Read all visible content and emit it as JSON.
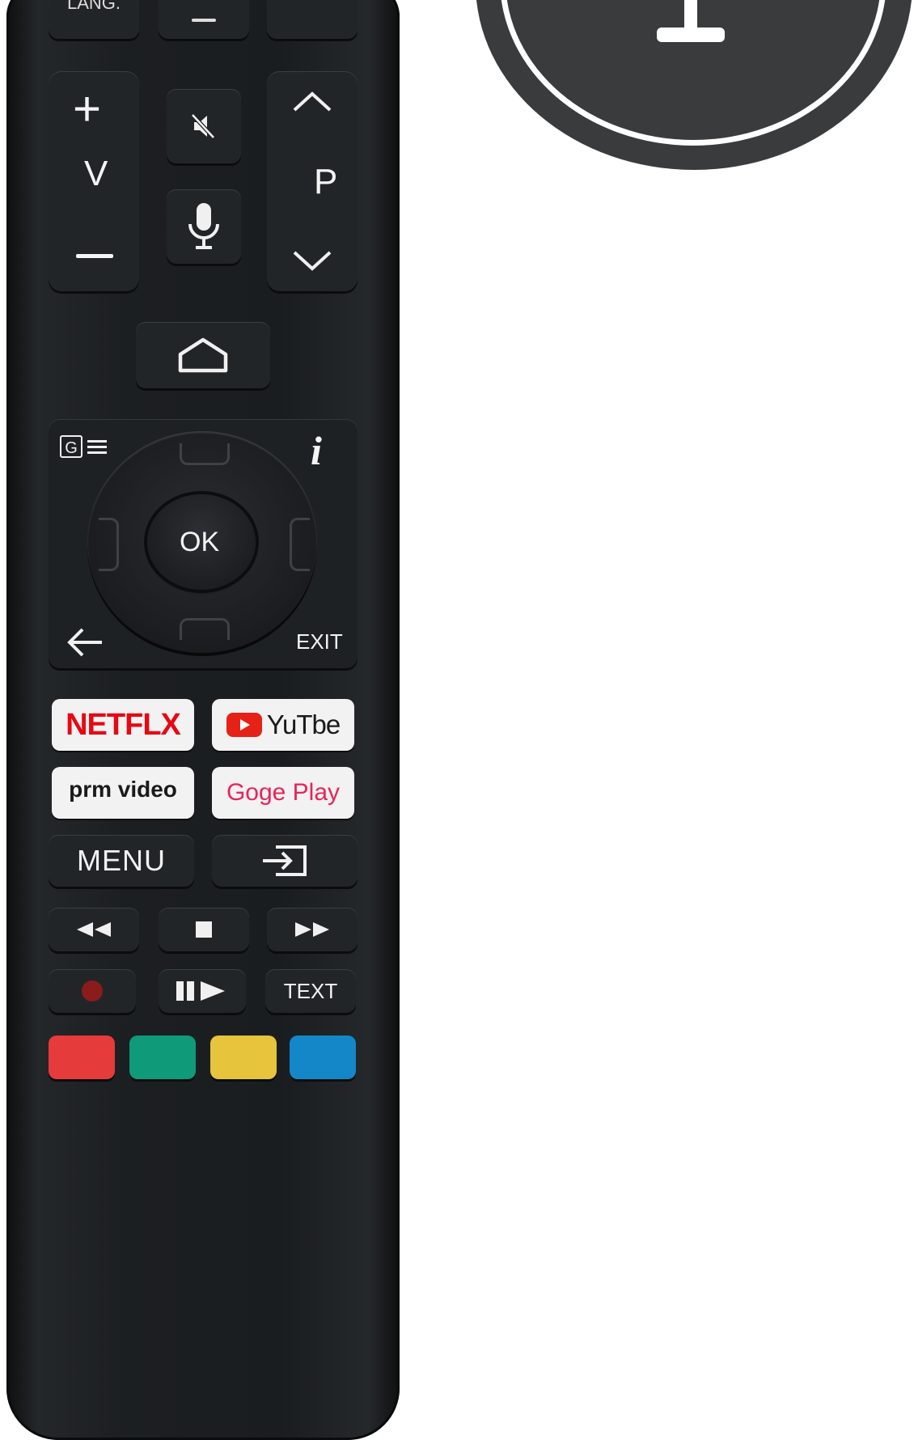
{
  "remote": {
    "top_partial_label": "LANG.",
    "volume": {
      "plus": "+",
      "label": "V",
      "minus": "—"
    },
    "program": {
      "label": "P"
    },
    "nav": {
      "ok": "OK",
      "info": "i",
      "exit": "EXIT",
      "guide": "G"
    },
    "apps": {
      "netflix": "NETFLX",
      "youtube": "YuTbe",
      "prime": "prm video",
      "google_play": "Goge Play"
    },
    "menu": "MENU",
    "text": "TEXT",
    "color_buttons": [
      "#e63b3b",
      "#0f9a7a",
      "#e6c43c",
      "#1487c8"
    ],
    "colors": {
      "netflix_red": "#e50914",
      "youtube_red": "#e62117",
      "google_play_pink": "#e8245a",
      "app_bg": "#f2f2f2",
      "record_dot": "#8a1c1c"
    }
  }
}
